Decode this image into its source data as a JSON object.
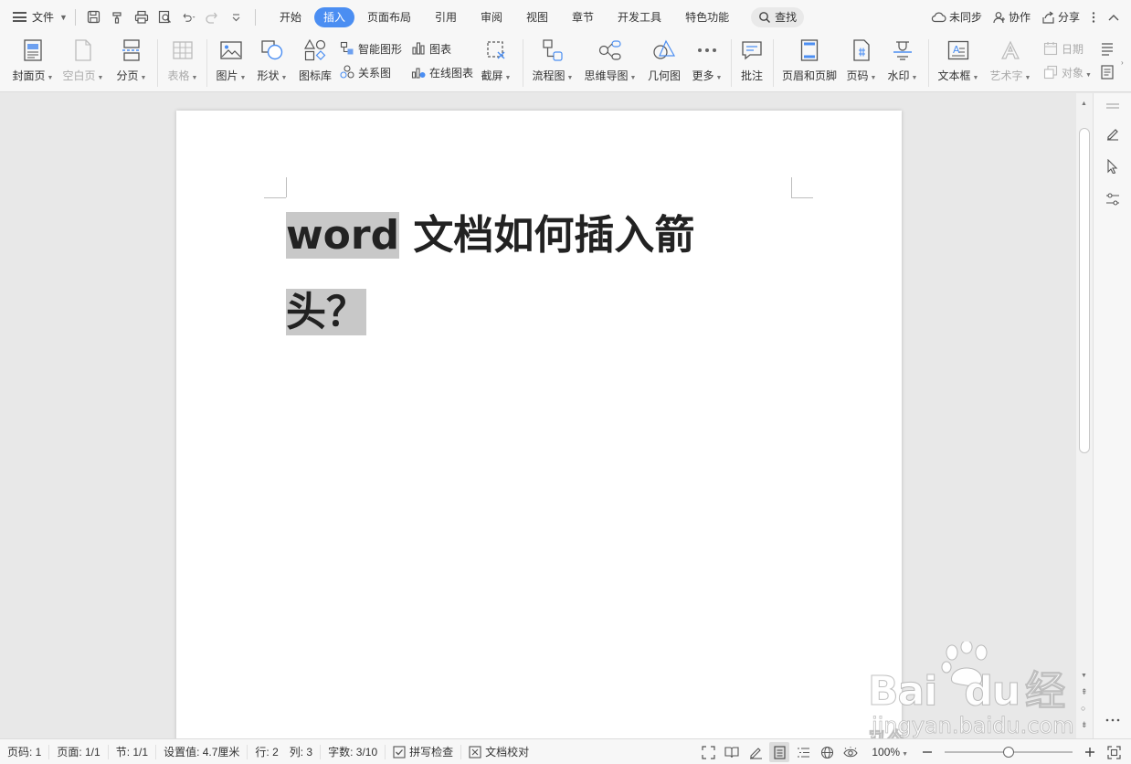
{
  "menubar": {
    "file_label": "文件",
    "tabs": [
      {
        "label": "开始"
      },
      {
        "label": "插入",
        "active": true
      },
      {
        "label": "页面布局"
      },
      {
        "label": "引用"
      },
      {
        "label": "审阅"
      },
      {
        "label": "视图"
      },
      {
        "label": "章节"
      },
      {
        "label": "开发工具"
      },
      {
        "label": "特色功能"
      }
    ],
    "search_label": "查找",
    "sync_label": "未同步",
    "collab_label": "协作",
    "share_label": "分享"
  },
  "ribbon": {
    "cover": "封面页",
    "blank": "空白页",
    "break": "分页",
    "table": "表格",
    "picture": "图片",
    "shape": "形状",
    "icon_lib": "图标库",
    "smart_art": "智能图形",
    "chart": "图表",
    "relation": "关系图",
    "online_chart": "在线图表",
    "screenshot": "截屏",
    "flowchart": "流程图",
    "mindmap": "思维导图",
    "geometry": "几何图",
    "more": "更多",
    "comment": "批注",
    "header_footer": "页眉和页脚",
    "page_num": "页码",
    "watermark": "水印",
    "textbox": "文本框",
    "wordart": "艺术字",
    "date": "日期",
    "object": "对象"
  },
  "document": {
    "title_highlighted": "word",
    "title_rest": " 文档如何插入箭",
    "title_line2": "头？"
  },
  "statusbar": {
    "page_code": "页码: 1",
    "page": "页面: 1/1",
    "section": "节: 1/1",
    "setting": "设置值: 4.7厘米",
    "row": "行: 2",
    "col": "列: 3",
    "word_count": "字数: 3/10",
    "spell_check": "拼写检查",
    "proofread": "文档校对",
    "zoom": "100%",
    "zoom_fraction": 0.5
  },
  "watermark": {
    "brand": "Bai",
    "brand2": "du",
    "brand_cn": "经验",
    "url": "jingyan.baidu.com"
  },
  "colors": {
    "accent": "#4b8ef2",
    "highlight": "#c8c8c8"
  }
}
